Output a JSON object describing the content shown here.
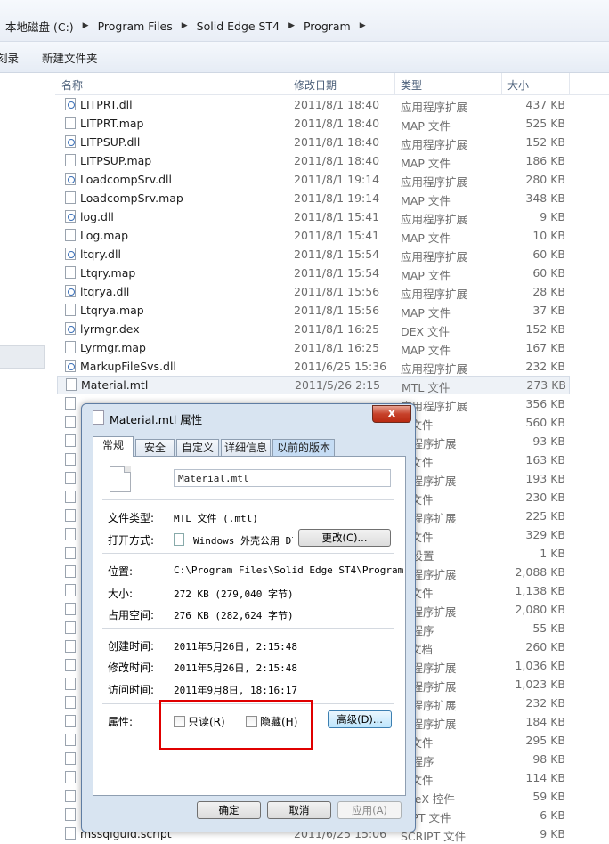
{
  "address": {
    "crumbs": [
      "本地磁盘 (C:)",
      "Program Files",
      "Solid Edge ST4",
      "Program"
    ]
  },
  "toolbar": {
    "items": [
      "刻录",
      "新建文件夹"
    ]
  },
  "columns": {
    "name": "名称",
    "date": "修改日期",
    "type": "类型",
    "size": "大小"
  },
  "files": [
    {
      "name": "LITPRT.dll",
      "date": "2011/8/1 18:40",
      "type": "应用程序扩展",
      "size": "437 KB"
    },
    {
      "name": "LITPRT.map",
      "date": "2011/8/1 18:40",
      "type": "MAP 文件",
      "size": "525 KB"
    },
    {
      "name": "LITPSUP.dll",
      "date": "2011/8/1 18:40",
      "type": "应用程序扩展",
      "size": "152 KB"
    },
    {
      "name": "LITPSUP.map",
      "date": "2011/8/1 18:40",
      "type": "MAP 文件",
      "size": "186 KB"
    },
    {
      "name": "LoadcompSrv.dll",
      "date": "2011/8/1 19:14",
      "type": "应用程序扩展",
      "size": "280 KB"
    },
    {
      "name": "LoadcompSrv.map",
      "date": "2011/8/1 19:14",
      "type": "MAP 文件",
      "size": "348 KB"
    },
    {
      "name": "log.dll",
      "date": "2011/8/1 15:41",
      "type": "应用程序扩展",
      "size": "9 KB"
    },
    {
      "name": "Log.map",
      "date": "2011/8/1 15:41",
      "type": "MAP 文件",
      "size": "10 KB"
    },
    {
      "name": "ltqry.dll",
      "date": "2011/8/1 15:54",
      "type": "应用程序扩展",
      "size": "60 KB"
    },
    {
      "name": "Ltqry.map",
      "date": "2011/8/1 15:54",
      "type": "MAP 文件",
      "size": "60 KB"
    },
    {
      "name": "ltqrya.dll",
      "date": "2011/8/1 15:56",
      "type": "应用程序扩展",
      "size": "28 KB"
    },
    {
      "name": "Ltqrya.map",
      "date": "2011/8/1 15:56",
      "type": "MAP 文件",
      "size": "37 KB"
    },
    {
      "name": "lyrmgr.dex",
      "date": "2011/8/1 16:25",
      "type": "DEX 文件",
      "size": "152 KB"
    },
    {
      "name": "Lyrmgr.map",
      "date": "2011/8/1 16:25",
      "type": "MAP 文件",
      "size": "167 KB"
    },
    {
      "name": "MarkupFileSvs.dll",
      "date": "2011/6/25 15:36",
      "type": "应用程序扩展",
      "size": "232 KB"
    },
    {
      "name": "Material.mtl",
      "date": "2011/5/26 2:15",
      "type": "MTL 文件",
      "size": "273 KB"
    },
    {
      "name": "",
      "date": "",
      "type": "应用程序扩展",
      "size": "356 KB"
    },
    {
      "name": "",
      "date": "",
      "type": "P 文件",
      "size": "560 KB"
    },
    {
      "name": "",
      "date": "",
      "type": "用程序扩展",
      "size": "93 KB"
    },
    {
      "name": "",
      "date": "",
      "type": "P 文件",
      "size": "163 KB"
    },
    {
      "name": "",
      "date": "",
      "type": "用程序扩展",
      "size": "193 KB"
    },
    {
      "name": "",
      "date": "",
      "type": "P 文件",
      "size": "230 KB"
    },
    {
      "name": "",
      "date": "",
      "type": "用程序扩展",
      "size": "225 KB"
    },
    {
      "name": "",
      "date": "",
      "type": "P 文件",
      "size": "329 KB"
    },
    {
      "name": "",
      "date": "",
      "type": "置设置",
      "size": "1 KB"
    },
    {
      "name": "",
      "date": "",
      "type": "用程序扩展",
      "size": "2,088 KB"
    },
    {
      "name": "",
      "date": "",
      "type": "P 文件",
      "size": "1,138 KB"
    },
    {
      "name": "",
      "date": "",
      "type": "用程序扩展",
      "size": "2,080 KB"
    },
    {
      "name": "",
      "date": "",
      "type": "用程序",
      "size": "55 KB"
    },
    {
      "name": "",
      "date": "",
      "type": "L 文档",
      "size": "260 KB"
    },
    {
      "name": "",
      "date": "",
      "type": "用程序扩展",
      "size": "1,036 KB"
    },
    {
      "name": "",
      "date": "",
      "type": "用程序扩展",
      "size": "1,023 KB"
    },
    {
      "name": "",
      "date": "",
      "type": "用程序扩展",
      "size": "232 KB"
    },
    {
      "name": "",
      "date": "",
      "type": "用程序扩展",
      "size": "184 KB"
    },
    {
      "name": "",
      "date": "",
      "type": "P 文件",
      "size": "295 KB"
    },
    {
      "name": "",
      "date": "",
      "type": "用程序",
      "size": "98 KB"
    },
    {
      "name": "",
      "date": "",
      "type": "P 文件",
      "size": "114 KB"
    },
    {
      "name": "",
      "date": "",
      "type": "tiveX 控件",
      "size": "59 KB"
    },
    {
      "name": "",
      "date": "",
      "type": "RIPT 文件",
      "size": "6 KB"
    },
    {
      "name": "mssqlguid.script",
      "date": "2011/6/25 15:06",
      "type": "SCRIPT 文件",
      "size": "9 KB"
    }
  ],
  "dialog": {
    "title": "Material.mtl 属性",
    "close": "x",
    "tabs": [
      "常规",
      "安全",
      "自定义",
      "详细信息",
      "以前的版本"
    ],
    "file_name": "Material.mtl",
    "type_label": "文件类型:",
    "type_value": "MTL 文件 (.mtl)",
    "open_label": "打开方式:",
    "open_value": "Windows 外壳公用 Dl",
    "change_btn": "更改(C)...",
    "location_label": "位置:",
    "location_value": "C:\\Program Files\\Solid Edge ST4\\Program",
    "size_label": "大小:",
    "size_value": "272 KB (279,040 字节)",
    "disk_label": "占用空间:",
    "disk_value": "276 KB (282,624 字节)",
    "created_label": "创建时间:",
    "created_value": "2011年5月26日, 2:15:48",
    "modified_label": "修改时间:",
    "modified_value": "2011年5月26日, 2:15:48",
    "accessed_label": "访问时间:",
    "accessed_value": "2011年9月8日, 18:16:17",
    "attr_label": "属性:",
    "readonly_label": "只读(R)",
    "hidden_label": "隐藏(H)",
    "advanced_btn": "高级(D)...",
    "ok_btn": "确定",
    "cancel_btn": "取消",
    "apply_btn": "应用(A)"
  }
}
